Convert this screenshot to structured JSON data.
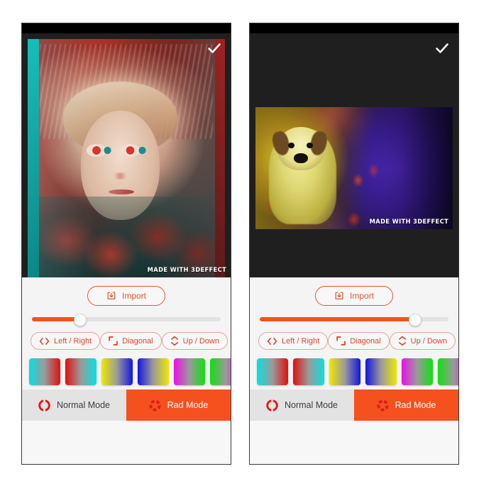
{
  "app": {
    "name": "3DEffect",
    "watermark": "MADE WITH 3DEFFECT"
  },
  "panels": [
    {
      "id": "left",
      "preview": {
        "subject": "portrait-anaglyph",
        "confirm_icon": "checkmark-icon",
        "watermark": "MADE WITH 3DEFFECT"
      },
      "import": {
        "label": "Import",
        "icon": "import-download-icon"
      },
      "slider": {
        "value": 25,
        "min": 0,
        "max": 100,
        "fill_color": "#f4511e",
        "track_color": "#e2e2e2"
      },
      "directions": [
        {
          "label": "Left / Right",
          "icon": "left-right-arrows-icon",
          "selected": false
        },
        {
          "label": "Diagonal",
          "icon": "diagonal-corners-icon",
          "selected": false
        },
        {
          "label": "Up / Down",
          "icon": "up-down-arrows-icon",
          "selected": false
        }
      ],
      "swatches": [
        {
          "name": "cyan-to-red",
          "from": "#08e0e0",
          "to": "#e01010"
        },
        {
          "name": "red-to-cyan",
          "from": "#e01010",
          "to": "#08e0e0"
        },
        {
          "name": "yellow-to-blue",
          "from": "#f0e800",
          "to": "#1414e0"
        },
        {
          "name": "blue-to-yellow",
          "from": "#1414e0",
          "to": "#f0e800"
        },
        {
          "name": "magenta-to-green",
          "from": "#e810e8",
          "to": "#10e010"
        },
        {
          "name": "green-to-magenta",
          "from": "#10e010",
          "to": "#e810e8"
        },
        {
          "name": "blue-to-yellow-2",
          "from": "#1414e0",
          "to": "#f0e800"
        },
        {
          "name": "yellow-to-blue-2",
          "from": "#f0e800",
          "to": "#1414e0"
        }
      ],
      "modes": [
        {
          "label": "Normal Mode",
          "icon": "split-ring-icon",
          "active": false
        },
        {
          "label": "Rad Mode",
          "icon": "segmented-ring-icon",
          "active": true
        }
      ]
    },
    {
      "id": "right",
      "preview": {
        "subject": "dog-in-poppies",
        "confirm_icon": "checkmark-icon",
        "watermark": "MADE WITH 3DEFFECT"
      },
      "import": {
        "label": "Import",
        "icon": "import-download-icon"
      },
      "slider": {
        "value": 82,
        "min": 0,
        "max": 100,
        "fill_color": "#f4511e",
        "track_color": "#e2e2e2"
      },
      "directions": [
        {
          "label": "Left / Right",
          "icon": "left-right-arrows-icon",
          "selected": false
        },
        {
          "label": "Diagonal",
          "icon": "diagonal-corners-icon",
          "selected": false
        },
        {
          "label": "Up / Down",
          "icon": "up-down-arrows-icon",
          "selected": false
        }
      ],
      "swatches": [
        {
          "name": "cyan-to-red",
          "from": "#08e0e0",
          "to": "#e01010"
        },
        {
          "name": "red-to-cyan",
          "from": "#e01010",
          "to": "#08e0e0"
        },
        {
          "name": "yellow-to-blue",
          "from": "#f0e800",
          "to": "#1414e0"
        },
        {
          "name": "blue-to-yellow",
          "from": "#1414e0",
          "to": "#f0e800"
        },
        {
          "name": "magenta-to-green",
          "from": "#e810e8",
          "to": "#10e010"
        },
        {
          "name": "green-to-magenta",
          "from": "#10e010",
          "to": "#e810e8"
        },
        {
          "name": "blue-to-yellow-2",
          "from": "#1414e0",
          "to": "#f0e800"
        },
        {
          "name": "yellow-to-blue-2",
          "from": "#f0e800",
          "to": "#1414e0"
        }
      ],
      "modes": [
        {
          "label": "Normal Mode",
          "icon": "split-ring-icon",
          "active": false
        },
        {
          "label": "Rad Mode",
          "icon": "segmented-ring-icon",
          "active": true
        }
      ]
    }
  ],
  "colors": {
    "accent": "#f4511e",
    "accent_outline": "#e8552a",
    "mode_inactive_bg": "#e3e3e3",
    "panel_bg": "#f4f4f4",
    "icon_red": "#e01b1b"
  }
}
